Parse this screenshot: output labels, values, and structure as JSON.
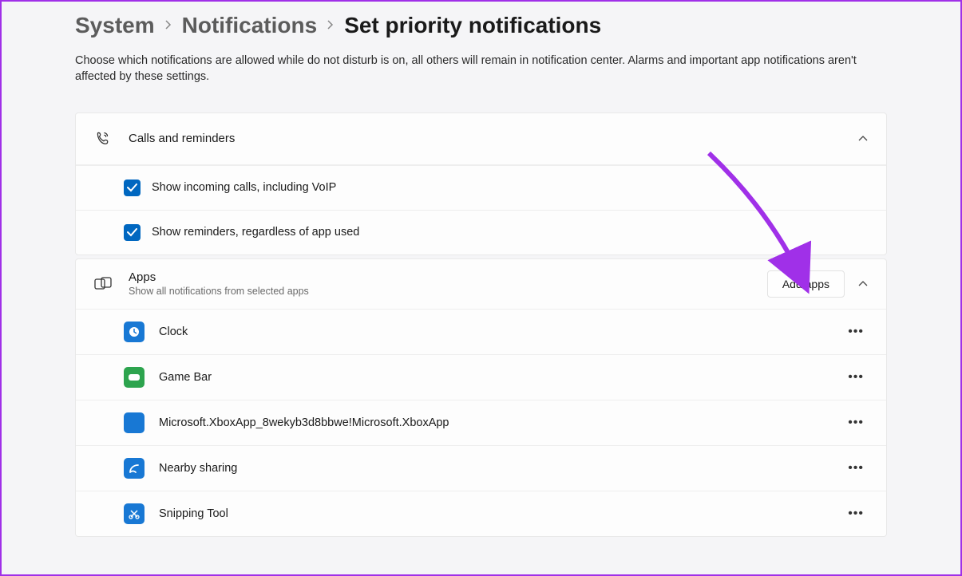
{
  "breadcrumb": {
    "item1": "System",
    "item2": "Notifications",
    "current": "Set priority notifications"
  },
  "description": "Choose which notifications are allowed while do not disturb is on, all others will remain in notification center. Alarms and important app notifications aren't affected by these settings.",
  "calls_section": {
    "title": "Calls and reminders",
    "option1": "Show incoming calls, including VoIP",
    "option2": "Show reminders, regardless of app used"
  },
  "apps_section": {
    "title": "Apps",
    "subtitle": "Show all notifications from selected apps",
    "add_button": "Add apps",
    "items": [
      {
        "name": "Clock"
      },
      {
        "name": "Game Bar"
      },
      {
        "name": "Microsoft.XboxApp_8wekyb3d8bbwe!Microsoft.XboxApp"
      },
      {
        "name": "Nearby sharing"
      },
      {
        "name": "Snipping Tool"
      }
    ]
  }
}
